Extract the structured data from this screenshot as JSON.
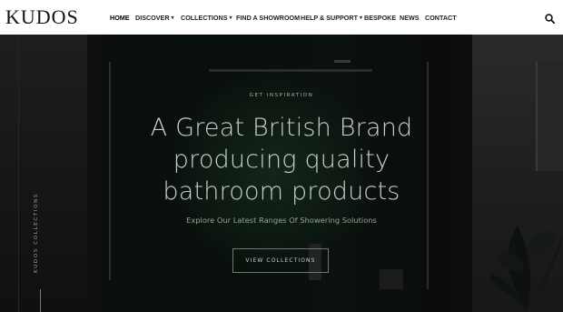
{
  "brand": {
    "logo_text": "KUDOS"
  },
  "nav": {
    "items": [
      {
        "label": "HOME",
        "has_dropdown": false,
        "active": true
      },
      {
        "label": "DISCOVER",
        "has_dropdown": true,
        "active": false
      },
      {
        "label": "COLLECTIONS",
        "has_dropdown": true,
        "active": false
      },
      {
        "label": "FIND A SHOWROOM",
        "has_dropdown": false,
        "active": false
      },
      {
        "label": "HELP & SUPPORT",
        "has_dropdown": true,
        "active": false
      },
      {
        "label": "BESPOKE",
        "has_dropdown": false,
        "active": false
      },
      {
        "label": "NEWS",
        "has_dropdown": false,
        "active": false
      },
      {
        "label": "CONTACT",
        "has_dropdown": false,
        "active": false
      }
    ],
    "search_icon": "search-icon"
  },
  "hero": {
    "eyebrow": "GET INSPIRATION",
    "headline_lines": [
      "A Great British Brand",
      "producing quality",
      "bathroom products"
    ],
    "subline": "Explore Our Latest Ranges Of Showering Solutions",
    "cta_label": "VIEW COLLECTIONS",
    "side_label": "KUDOS COLLECTIONS"
  },
  "colors": {
    "header_bg": "#ffffff",
    "hero_accent": "#0c130f",
    "text_light": "#c8d1cb"
  }
}
